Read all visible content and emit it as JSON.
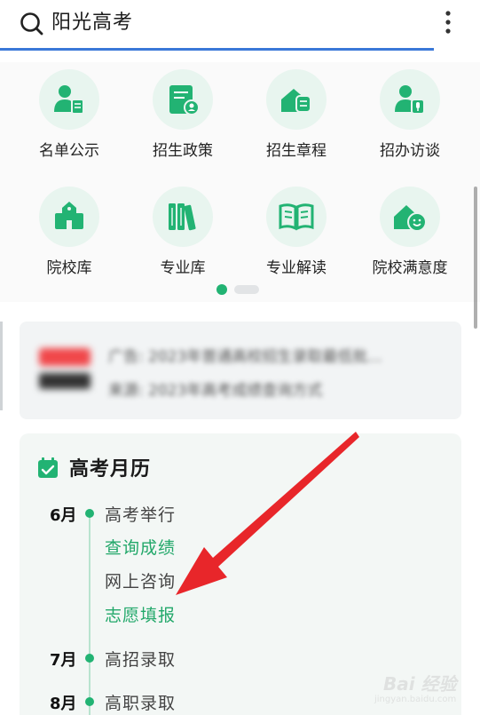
{
  "search": {
    "text": "阳光高考"
  },
  "grid": {
    "items": [
      {
        "label": "名单公示",
        "icon": "person-doc-icon"
      },
      {
        "label": "招生政策",
        "icon": "policy-doc-icon"
      },
      {
        "label": "招生章程",
        "icon": "house-doc-icon"
      },
      {
        "label": "招办访谈",
        "icon": "person-mic-icon"
      },
      {
        "label": "院校库",
        "icon": "school-building-icon"
      },
      {
        "label": "专业库",
        "icon": "books-icon"
      },
      {
        "label": "专业解读",
        "icon": "open-book-icon"
      },
      {
        "label": "院校满意度",
        "icon": "house-smile-icon"
      }
    ],
    "page_indicator": {
      "current": 1,
      "total": 2
    }
  },
  "ad": {
    "line1": "广告: 2023年普通高校招生录取最低批...",
    "line2": "来源: 2023年高考成绩查询方式"
  },
  "calendar": {
    "title": "高考月历",
    "entries": [
      {
        "month": "6月",
        "events": [
          {
            "text": "高考举行",
            "link": false
          },
          {
            "text": "查询成绩",
            "link": true
          },
          {
            "text": "网上咨询",
            "link": false
          },
          {
            "text": "志愿填报",
            "link": true
          }
        ]
      },
      {
        "month": "7月",
        "events": [
          {
            "text": "高招录取",
            "link": false
          }
        ]
      },
      {
        "month": "8月",
        "events": [
          {
            "text": "高职录取",
            "link": false
          }
        ]
      }
    ]
  },
  "watermark": {
    "text": "Bai 经验",
    "sub": "jingyan.baidu.com"
  },
  "colors": {
    "accent": "#22b373",
    "link": "#22a86a",
    "search_underline": "#3a78d8",
    "arrow": "#e8262a",
    "icon_bg": "#e8f5ef"
  }
}
